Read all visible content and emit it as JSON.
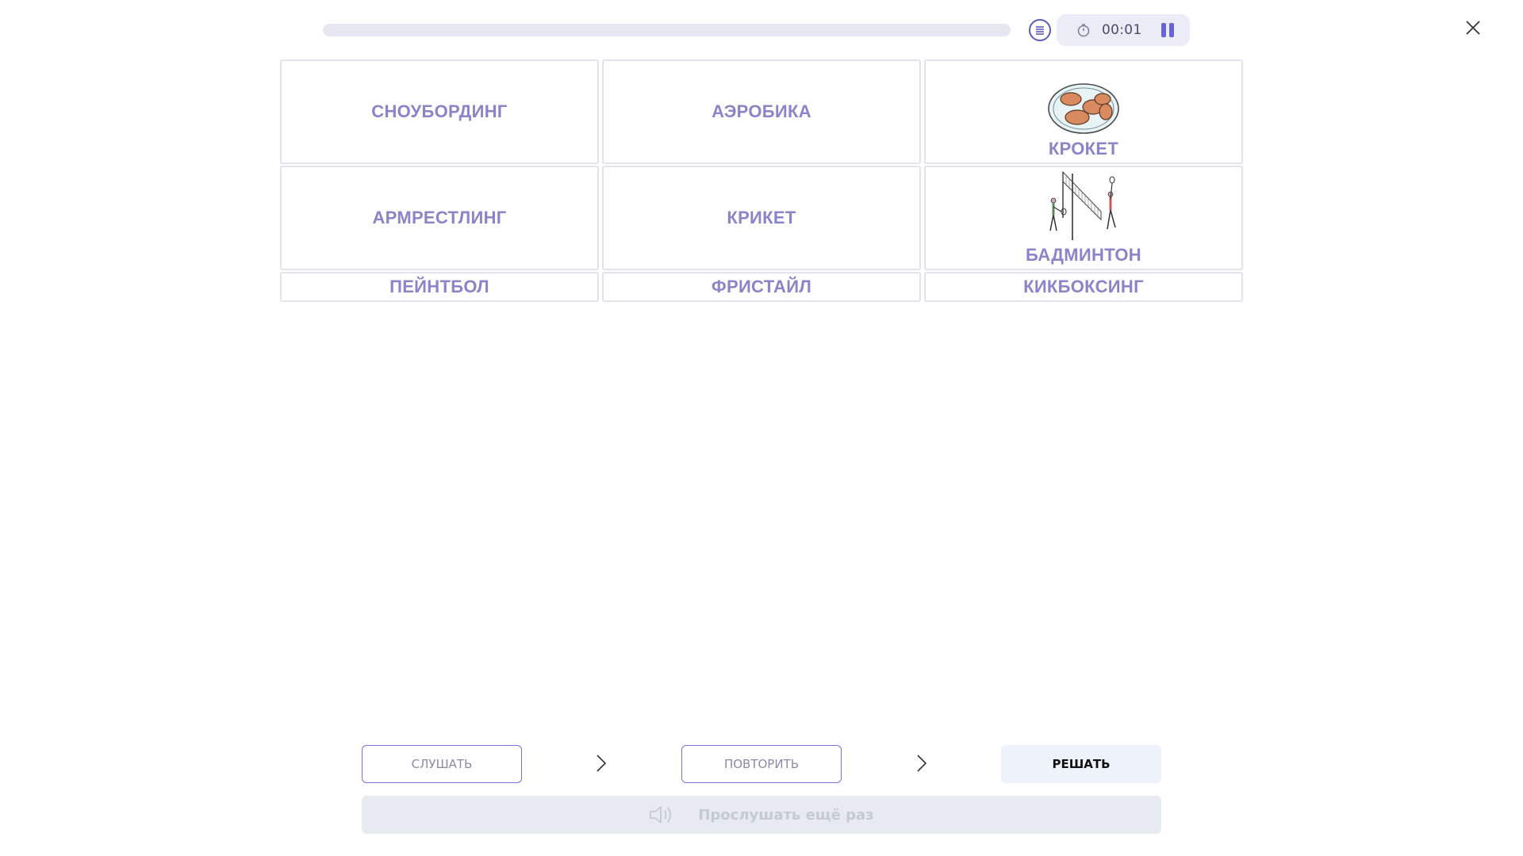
{
  "topbar": {
    "progress_fraction": 0.0,
    "timer": "00:01",
    "icons": {
      "list": "list-lines-icon",
      "stopwatch": "stopwatch-icon",
      "pause": "pause-icon",
      "close": "close-icon"
    }
  },
  "cells": [
    {
      "label": "СНОУБОРДИНГ"
    },
    {
      "label": "АЭРОБИКА"
    },
    {
      "label": "КРОКЕТ",
      "image": "croquette-plate"
    },
    {
      "label": "АРМРЕСТЛИНГ"
    },
    {
      "label": "КРИКЕТ"
    },
    {
      "label": "БАДМИНТОН",
      "image": "badminton-players"
    },
    {
      "label": "ПЕЙНТБОЛ"
    },
    {
      "label": "ФРИСТАЙЛ"
    },
    {
      "label": "КИКБОКСИНГ"
    }
  ],
  "steps": {
    "listen": "СЛУШАТЬ",
    "repeat": "ПОВТОРИТЬ",
    "solve": "РЕШАТЬ"
  },
  "replay": {
    "label": "Прослушать ещё раз",
    "icon": "speaker-icon"
  },
  "colors": {
    "accent": "#6a64d2",
    "label": "#8a84c8",
    "outline": "#7b6fe0"
  }
}
